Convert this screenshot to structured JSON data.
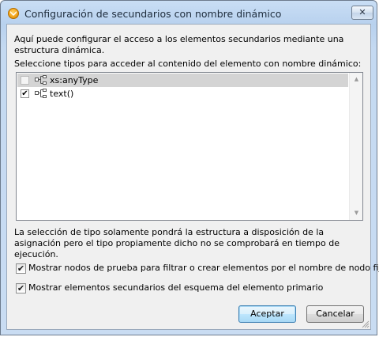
{
  "window": {
    "title": "Configuración de secundarios con nombre dinámico",
    "close_glyph": "✕"
  },
  "description": "Aquí puede configurar el acceso a los elementos secundarios mediante una estructura dinámica.",
  "list_label": "Seleccione tipos para acceder al contenido del elemento con nombre dinámico:",
  "types": [
    {
      "label": "xs:anyType",
      "checked": false,
      "selected": true,
      "disabled": true
    },
    {
      "label": "text()",
      "checked": true,
      "selected": false,
      "disabled": false
    }
  ],
  "check_glyph": "✔",
  "note": "La selección de tipo solamente pondrá la estructura a disposición de la asignación pero el tipo propiamente dicho no se comprobará en tiempo de ejecución.",
  "options": [
    {
      "label": "Mostrar nodos de prueba para filtrar o crear elementos por el nombre de nodo fijo",
      "checked": true
    },
    {
      "label": "Mostrar elementos secundarios del esquema del elemento primario",
      "checked": true
    }
  ],
  "buttons": {
    "ok": "Aceptar",
    "cancel": "Cancelar"
  },
  "icons": {
    "app": "mapforce-icon",
    "tree": "tree-structure-icon",
    "scroll_up": "▲",
    "scroll_down": "▼"
  }
}
